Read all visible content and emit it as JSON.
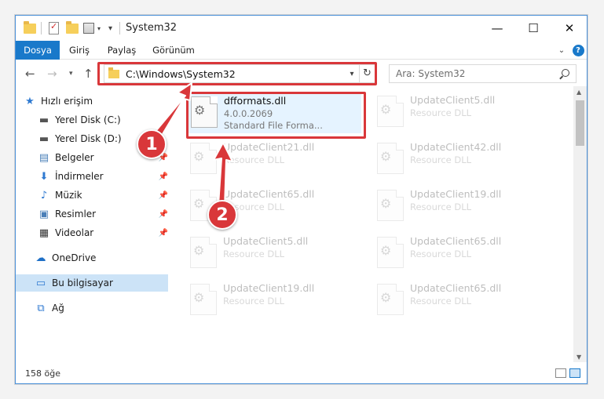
{
  "window": {
    "title": "System32"
  },
  "ribbon": {
    "tabs": [
      "Dosya",
      "Giriş",
      "Paylaş",
      "Görünüm"
    ]
  },
  "address": {
    "path": "C:\\Windows\\System32"
  },
  "search": {
    "placeholder": "Ara: System32"
  },
  "sidebar": {
    "items": [
      {
        "label": "Hızlı erişim",
        "icon": "star-icon"
      },
      {
        "label": "Yerel Disk (C:)",
        "icon": "drive-icon"
      },
      {
        "label": "Yerel Disk (D:)",
        "icon": "drive-icon"
      },
      {
        "label": "Belgeler",
        "icon": "documents-icon"
      },
      {
        "label": "İndirmeler",
        "icon": "download-icon"
      },
      {
        "label": "Müzik",
        "icon": "music-icon"
      },
      {
        "label": "Resimler",
        "icon": "pictures-icon"
      },
      {
        "label": "Videolar",
        "icon": "videos-icon"
      },
      {
        "label": "OneDrive",
        "icon": "cloud-icon"
      },
      {
        "label": "Bu bilgisayar",
        "icon": "computer-icon"
      },
      {
        "label": "Ağ",
        "icon": "network-icon"
      }
    ]
  },
  "files": {
    "selected": {
      "name": "dfformats.dll",
      "version": "4.0.0.2069",
      "type": "Standard File Forma..."
    },
    "faded": [
      {
        "name": "UpdateClient5.dll",
        "type": "Resource DLL"
      },
      {
        "name": "UpdateClient21.dll",
        "type": "Resource DLL"
      },
      {
        "name": "UpdateClient42.dll",
        "type": "Resource DLL"
      },
      {
        "name": "UpdateClient65.dll",
        "type": "Resource DLL"
      },
      {
        "name": "UpdateClient19.dll",
        "type": "Resource DLL"
      },
      {
        "name": "UpdateClient5.dll",
        "type": "Resource DLL"
      },
      {
        "name": "UpdateClient65.dll",
        "type": "Resource DLL"
      },
      {
        "name": "UpdateClient19.dll",
        "type": "Resource DLL"
      },
      {
        "name": "UpdateClient65.dll",
        "type": "Resource DLL"
      }
    ]
  },
  "status": {
    "count": "158 öğe"
  },
  "annotations": {
    "step1": "1",
    "step2": "2"
  },
  "colors": {
    "accent": "#1979ca",
    "highlight": "#d9373a"
  }
}
